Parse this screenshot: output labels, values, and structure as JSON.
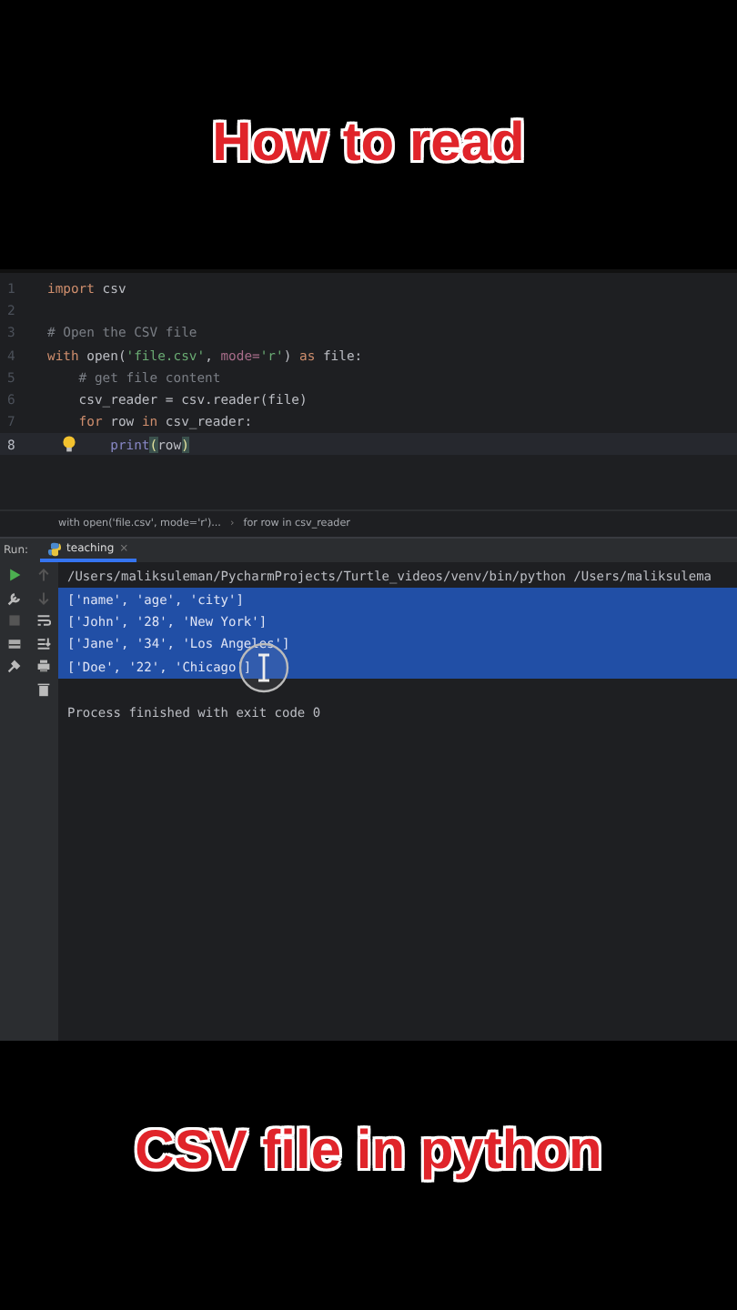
{
  "caption_top": "How to read",
  "editor": {
    "lines": [
      {
        "number": "1",
        "current": false,
        "bulb": false,
        "tokens": [
          {
            "text": "import",
            "kind": "kw"
          },
          {
            "text": " csv",
            "kind": "plain"
          }
        ]
      },
      {
        "number": "2",
        "current": false
      },
      {
        "number": "3",
        "current": false,
        "bulb": false,
        "tokens": [
          {
            "text": "# Open the CSV file",
            "kind": "comment"
          }
        ]
      },
      {
        "number": "4",
        "current": false,
        "bulb": false,
        "tokens": [
          {
            "text": "with",
            "kind": "kw"
          },
          {
            "text": " open(",
            "kind": "plain"
          },
          {
            "text": "'file.csv'",
            "kind": "str"
          },
          {
            "text": ", ",
            "kind": "plain"
          },
          {
            "text": "mode=",
            "kind": "param"
          },
          {
            "text": "'r'",
            "kind": "str"
          },
          {
            "text": ") ",
            "kind": "plain"
          },
          {
            "text": "as",
            "kind": "kw"
          },
          {
            "text": " file:",
            "kind": "plain"
          }
        ]
      },
      {
        "number": "5",
        "current": false,
        "bulb": false,
        "tokens": [
          {
            "text": "    # get file content",
            "kind": "comment"
          }
        ]
      },
      {
        "number": "6",
        "current": false,
        "bulb": false,
        "tokens": [
          {
            "text": "    csv_reader = csv.reader(file)",
            "kind": "plain"
          }
        ]
      },
      {
        "number": "7",
        "current": false,
        "bulb": false,
        "tokens": [
          {
            "text": "    for",
            "kind": "kw"
          },
          {
            "text": " row ",
            "kind": "plain"
          },
          {
            "text": "in",
            "kind": "kw"
          },
          {
            "text": " csv_reader:",
            "kind": "plain"
          }
        ]
      },
      {
        "number": "8",
        "current": true,
        "bulb": true,
        "tokens": [
          {
            "text": "        print",
            "kind": "builtin"
          },
          {
            "text": "(",
            "kind": "match"
          },
          {
            "text": "row",
            "kind": "plain"
          },
          {
            "text": ")",
            "kind": "match"
          }
        ]
      }
    ]
  },
  "breadcrumbs": [
    "with open('file.csv', mode='r')...",
    "for row in csv_reader"
  ],
  "breadcrumb_separator": "›",
  "run": {
    "label": "Run:",
    "tab": "teaching",
    "tab_close": "×",
    "console": [
      {
        "text": "/Users/maliksuleman/PycharmProjects/Turtle_videos/venv/bin/python /Users/maliksulema",
        "selected": false
      },
      {
        "text": "['name', 'age', 'city']",
        "selected": true
      },
      {
        "text": "['John', '28', 'New York']",
        "selected": true
      },
      {
        "text": "['Jane', '34', 'Los Angeles']",
        "selected": true
      },
      {
        "text": "['Doe', '22', 'Chicago']",
        "selected": true
      },
      {
        "selected": false
      },
      {
        "text": "Process finished with exit code 0",
        "selected": false
      }
    ]
  },
  "caption_bottom": "CSV file in python"
}
